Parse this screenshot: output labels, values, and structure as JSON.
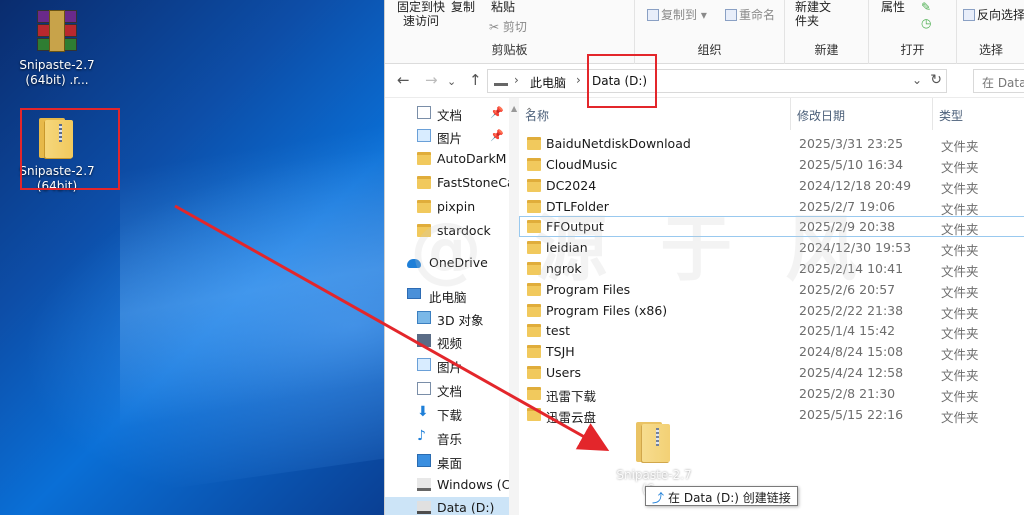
{
  "desktop": {
    "icons": [
      {
        "label": "Snipaste-2.7 (64bit) .r..."
      },
      {
        "label": "Snipaste-2.7 (64bit)"
      }
    ]
  },
  "ribbon": {
    "clipboard": {
      "pin_label": "固定到快速访问",
      "copy_label": "复制",
      "paste_label": "粘贴",
      "cut_label": "剪切",
      "group_label": "剪贴板"
    },
    "organize": {
      "copy_to_label": "复制到",
      "rename_label": "重命名",
      "group_label": "组织"
    },
    "new": {
      "new_folder_label": "新建文件夹",
      "group_label": "新建"
    },
    "open": {
      "properties_label": "属性",
      "group_label": "打开"
    },
    "select": {
      "invert_label": "反向选择",
      "group_label": "选择"
    }
  },
  "address": {
    "crumbs": [
      "此电脑",
      "Data (D:)"
    ],
    "search_placeholder": "在 Data"
  },
  "nav_pane": {
    "items": [
      {
        "label": "文档",
        "icon": "doc",
        "pinned": true
      },
      {
        "label": "图片",
        "icon": "pic",
        "pinned": true
      },
      {
        "label": "AutoDarkM",
        "icon": "fold"
      },
      {
        "label": "FastStoneCa",
        "icon": "fold"
      },
      {
        "label": "pixpin",
        "icon": "fold"
      },
      {
        "label": "stardock",
        "icon": "fold"
      },
      {
        "label": "OneDrive",
        "icon": "cloud"
      },
      {
        "label": "此电脑",
        "icon": "pc"
      },
      {
        "label": "3D 对象",
        "icon": "cube"
      },
      {
        "label": "视频",
        "icon": "video"
      },
      {
        "label": "图片",
        "icon": "pic"
      },
      {
        "label": "文档",
        "icon": "doc"
      },
      {
        "label": "下载",
        "icon": "down"
      },
      {
        "label": "音乐",
        "icon": "music"
      },
      {
        "label": "桌面",
        "icon": "desk"
      },
      {
        "label": "Windows (C",
        "icon": "win"
      },
      {
        "label": "Data (D:)",
        "icon": "drv",
        "selected": true
      }
    ]
  },
  "columns": {
    "name": "名称",
    "date": "修改日期",
    "type": "类型"
  },
  "files": [
    {
      "name": "BaiduNetdiskDownload",
      "date": "2025/3/31 23:25",
      "type": "文件夹"
    },
    {
      "name": "CloudMusic",
      "date": "2025/5/10 16:34",
      "type": "文件夹"
    },
    {
      "name": "DC2024",
      "date": "2024/12/18 20:49",
      "type": "文件夹"
    },
    {
      "name": "DTLFolder",
      "date": "2025/2/7 19:06",
      "type": "文件夹"
    },
    {
      "name": "FFOutput",
      "date": "2025/2/9 20:38",
      "type": "文件夹"
    },
    {
      "name": "leidian",
      "date": "2024/12/30 19:53",
      "type": "文件夹"
    },
    {
      "name": "ngrok",
      "date": "2025/2/14 10:41",
      "type": "文件夹"
    },
    {
      "name": "Program Files",
      "date": "2025/2/6 20:57",
      "type": "文件夹"
    },
    {
      "name": "Program Files (x86)",
      "date": "2025/2/22 21:38",
      "type": "文件夹"
    },
    {
      "name": "test",
      "date": "2025/1/4 15:42",
      "type": "文件夹"
    },
    {
      "name": "TSJH",
      "date": "2024/8/24 15:08",
      "type": "文件夹"
    },
    {
      "name": "Users",
      "date": "2025/4/24 12:58",
      "type": "文件夹"
    },
    {
      "name": "迅雷下载",
      "date": "2025/2/8 21:30",
      "type": "文件夹"
    },
    {
      "name": "迅雷云盘",
      "date": "2025/5/15 22:16",
      "type": "文件夹"
    }
  ],
  "drag": {
    "ghost_label": "Snipaste-2.7 (6...",
    "tooltip_target": "在 Data (D:) 创建链接"
  }
}
